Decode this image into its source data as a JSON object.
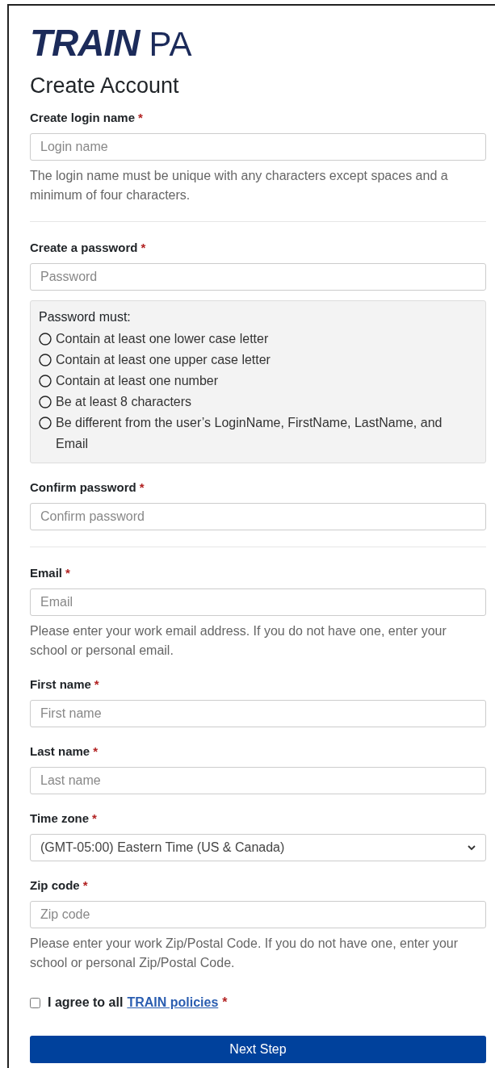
{
  "logo": {
    "brand": "TRAIN",
    "region": "PA"
  },
  "title": "Create Account",
  "fields": [
    {
      "kind": "input",
      "label": "Create login name",
      "required_mark": "*",
      "placeholder": "Login name",
      "help": "The login name must be unique with any characters except spaces and a minimum of four characters."
    },
    {
      "kind": "divider"
    },
    {
      "kind": "input",
      "label": "Create a password",
      "required_mark": "*",
      "placeholder": "Password",
      "rules": {
        "heading": "Password must:",
        "items": [
          {
            "text": "Contain at least one lower case letter",
            "met": false
          },
          {
            "text": "Contain at least one upper case letter",
            "met": false
          },
          {
            "text": "Contain at least one number",
            "met": false
          },
          {
            "text": "Be at least 8 characters",
            "met": false
          },
          {
            "text": "Be different from the user’s LoginName, FirstName, LastName, and Email",
            "met": false
          }
        ]
      }
    },
    {
      "kind": "input",
      "label": "Confirm password",
      "required_mark": "*",
      "placeholder": "Confirm password"
    },
    {
      "kind": "divider"
    },
    {
      "kind": "input",
      "label": "Email",
      "required_mark": "*",
      "placeholder": "Email",
      "help": "Please enter your work email address. If you do not have one, enter your school or personal email."
    },
    {
      "kind": "input",
      "label": "First name",
      "required_mark": "*",
      "placeholder": "First name"
    },
    {
      "kind": "input",
      "label": "Last name",
      "required_mark": "*",
      "placeholder": "Last name"
    },
    {
      "kind": "select",
      "label": "Time zone",
      "required_mark": "*",
      "value": "(GMT-05:00) Eastern Time (US & Canada)"
    },
    {
      "kind": "input",
      "label": "Zip code",
      "required_mark": "*",
      "placeholder": "Zip code",
      "help": "Please enter your work Zip/Postal Code. If you do not have one, enter your school or personal Zip/Postal Code."
    }
  ],
  "agree": {
    "text": "I agree to all",
    "link": "TRAIN policies",
    "required_mark": "*",
    "checked": false
  },
  "submit": "Next Step"
}
